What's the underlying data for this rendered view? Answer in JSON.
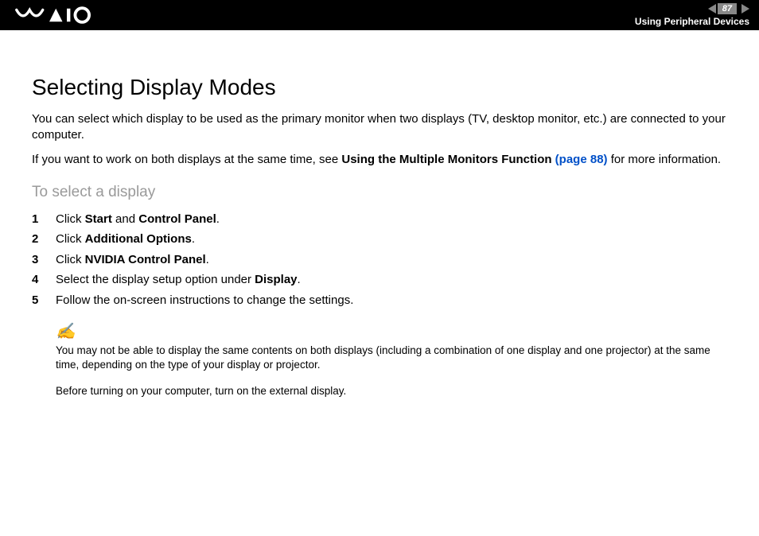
{
  "header": {
    "page_number": "87",
    "section": "Using Peripheral Devices"
  },
  "title": "Selecting Display Modes",
  "intro1": "You can select which display to be used as the primary monitor when two displays (TV, desktop monitor, etc.) are connected to your computer.",
  "intro2_pre": "If you want to work on both displays at the same time, see ",
  "intro2_bold": "Using the Multiple Monitors Function",
  "intro2_link": " (page 88)",
  "intro2_post": " for more information.",
  "subhead": "To select a display",
  "steps": {
    "s1_pre": "Click ",
    "s1_b1": "Start",
    "s1_mid": " and ",
    "s1_b2": "Control Panel",
    "s1_post": ".",
    "s2_pre": "Click ",
    "s2_b": "Additional Options",
    "s2_post": ".",
    "s3_pre": "Click ",
    "s3_b": "NVIDIA Control Panel",
    "s3_post": ".",
    "s4_pre": "Select the display setup option under ",
    "s4_b": "Display",
    "s4_post": ".",
    "s5": "Follow the on-screen instructions to change the settings."
  },
  "note_icon": "✍",
  "note1": "You may not be able to display the same contents on both displays (including a combination of one display and one projector) at the same time, depending on the type of your display or projector.",
  "note2": "Before turning on your computer, turn on the external display."
}
